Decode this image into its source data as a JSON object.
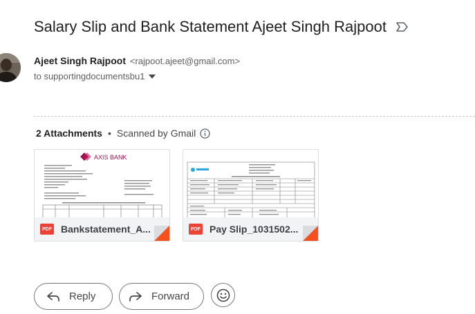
{
  "email": {
    "subject": "Salary Slip and Bank Statement Ajeet Singh Rajpoot",
    "sender_name": "Ajeet Singh Rajpoot",
    "sender_email": "<rajpoot.ajeet@gmail.com>",
    "recipient": "to supportingdocumentsbu1"
  },
  "attachments": {
    "count_label": "2 Attachments",
    "separator": "•",
    "scanned_label": "Scanned by Gmail",
    "items": [
      {
        "filename": "Bankstatement_A...",
        "type": "PDF",
        "preview_brand": "AXIS BANK"
      },
      {
        "filename": "Pay Slip_1031502...",
        "type": "PDF"
      }
    ]
  },
  "actions": {
    "reply_label": "Reply",
    "forward_label": "Forward"
  },
  "icons": [
    "label-icon",
    "caret-down-icon",
    "info-icon",
    "pdf-icon",
    "reply-icon",
    "forward-icon",
    "emoji-icon"
  ],
  "colors": {
    "pdf_red": "#ea4335",
    "corner_orange": "#f4511e",
    "axis_maroon": "#97144d"
  }
}
